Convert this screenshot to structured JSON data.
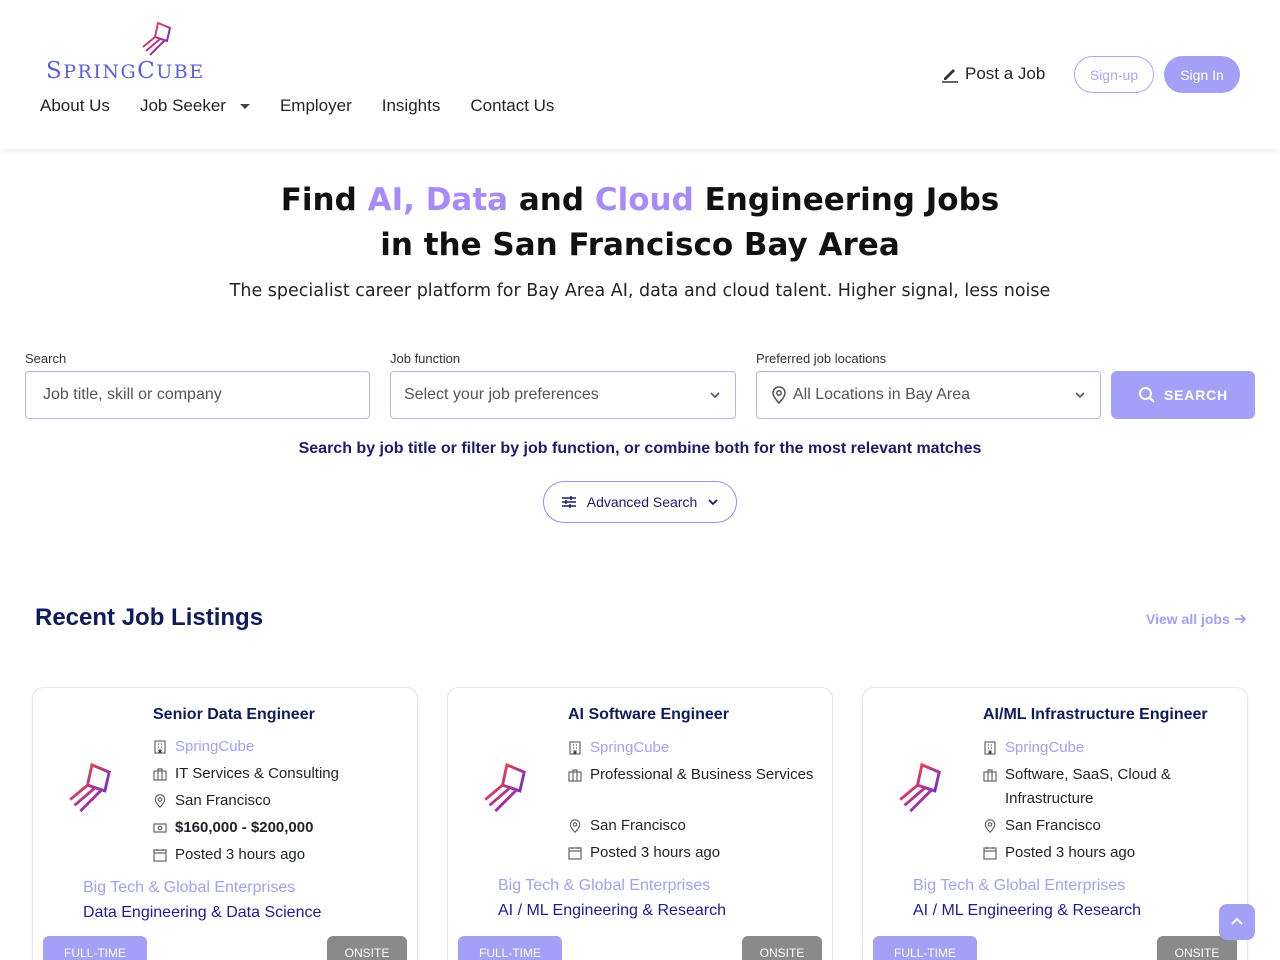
{
  "brand": {
    "name_first": "S",
    "name_rest1": "PRING",
    "name_second": "C",
    "name_rest2": "UBE"
  },
  "nav": {
    "items": [
      {
        "label": "About Us"
      },
      {
        "label": "Job Seeker"
      },
      {
        "label": "Employer"
      },
      {
        "label": "Insights"
      },
      {
        "label": "Contact Us"
      }
    ]
  },
  "header_actions": {
    "post_job": "Post a Job",
    "signup": "Sign-up",
    "signin": "Sign In"
  },
  "hero": {
    "w1": "Find",
    "w2": "AI, Data",
    "w3": "and",
    "w4": "Cloud",
    "w5": "Engineering Jobs",
    "line2": "in the San Francisco Bay Area",
    "subtitle": "The specialist career platform for Bay Area AI, data and cloud talent. Higher signal, less noise"
  },
  "search": {
    "search_label": "Search",
    "search_placeholder": "Job title, skill or company",
    "function_label": "Job function",
    "function_value": "Select your job preferences",
    "location_label": "Preferred job locations",
    "location_value": "All Locations in Bay Area",
    "button": "SEARCH",
    "hint": "Search by job title or filter by job function, or combine both for the most relevant matches",
    "advanced": "Advanced Search"
  },
  "listings": {
    "title": "Recent Job Listings",
    "view_all": "View all jobs",
    "jobs": [
      {
        "title": "Senior Data Engineer",
        "company": "SpringCube",
        "industry": "IT Services & Consulting",
        "location": "San Francisco",
        "salary": "$160,000 - $200,000",
        "posted": "Posted 3 hours ago",
        "category": "Big Tech & Global Enterprises",
        "function": "Data Engineering & Data Science",
        "type": "FULL-TIME",
        "mode": "ONSITE"
      },
      {
        "title": "AI Software Engineer",
        "company": "SpringCube",
        "industry": "Professional & Business Services",
        "location": "San Francisco",
        "posted": "Posted 3 hours ago",
        "category": "Big Tech & Global Enterprises",
        "function": "AI / ML Engineering & Research",
        "type": "FULL-TIME",
        "mode": "ONSITE"
      },
      {
        "title": "AI/ML Infrastructure Engineer",
        "company": "SpringCube",
        "industry": "Software, SaaS, Cloud & Infrastructure",
        "location": "San Francisco",
        "posted": "Posted 3 hours ago",
        "category": "Big Tech & Global Enterprises",
        "function": "AI / ML Engineering & Research",
        "type": "FULL-TIME",
        "mode": "ONSITE"
      }
    ]
  },
  "colors": {
    "accent": "#a3a1f7",
    "heading": "#0f1b5c",
    "hero_accent": "#a78bfa"
  }
}
